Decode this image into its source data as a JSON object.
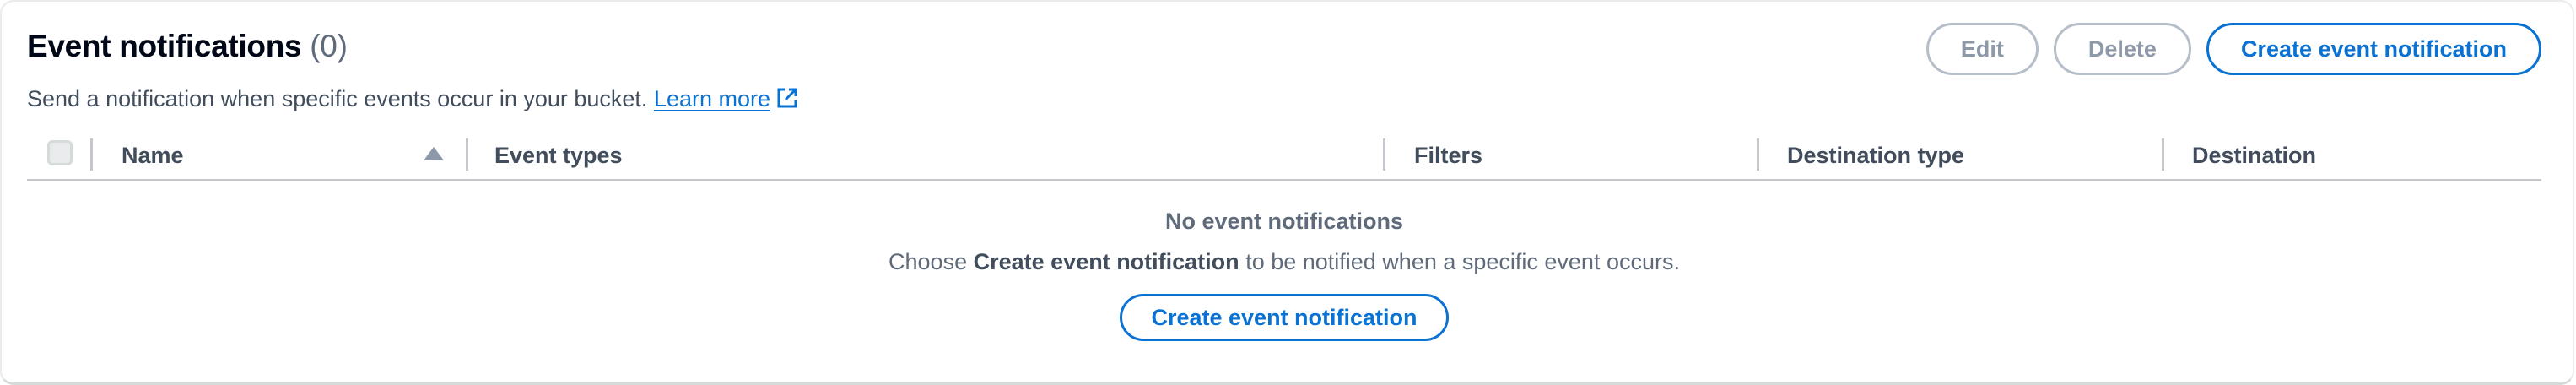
{
  "header": {
    "title": "Event notifications",
    "count": "(0)",
    "description": "Send a notification when specific events occur in your bucket.",
    "learn_more": "Learn more",
    "actions": {
      "edit": "Edit",
      "delete": "Delete",
      "create": "Create event notification"
    }
  },
  "table": {
    "columns": [
      "Name",
      "Event types",
      "Filters",
      "Destination type",
      "Destination"
    ],
    "sort_icon": "sort-ascending-icon"
  },
  "empty_state": {
    "title": "No event notifications",
    "desc_before": "Choose",
    "desc_bold": "Create event notification",
    "desc_after": "to be notified when a specific event occurs.",
    "button": "Create event notification"
  },
  "colors": {
    "link": "#0972d3",
    "disabled_text": "#8d99a8",
    "header_text": "#414d5c"
  }
}
